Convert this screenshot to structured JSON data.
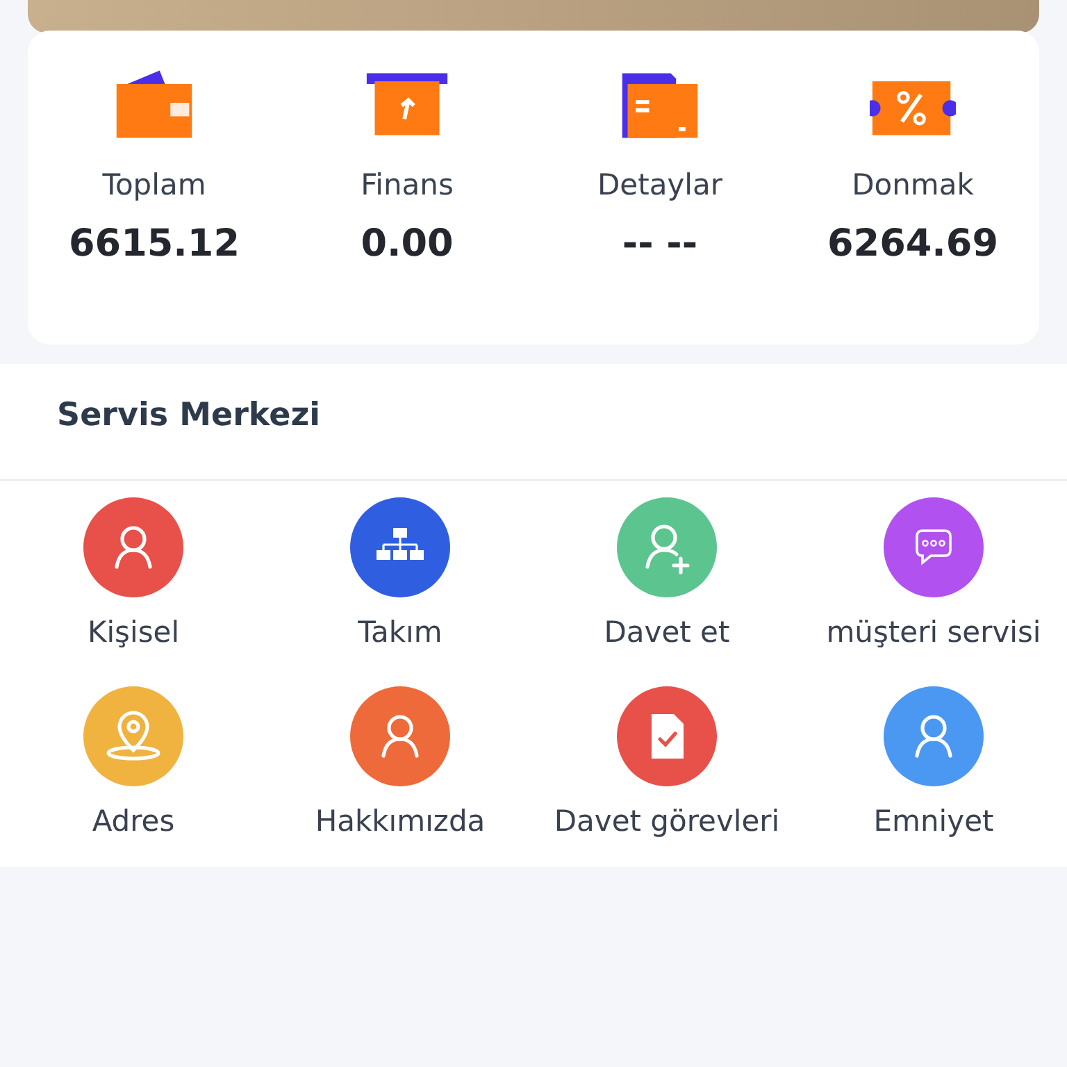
{
  "stats": [
    {
      "kind": "wallet",
      "label": "Toplam",
      "value": "6615.12"
    },
    {
      "kind": "box",
      "label": "Finans",
      "value": "0.00"
    },
    {
      "kind": "card",
      "label": "Detaylar",
      "value": "-- --"
    },
    {
      "kind": "coupon",
      "label": "Donmak",
      "value": "6264.69"
    }
  ],
  "service_center": {
    "title": "Servis Merkezi",
    "items": [
      {
        "kind": "person",
        "label": "Kişisel",
        "color": "#e8504a"
      },
      {
        "kind": "org-chart",
        "label": "Takım",
        "color": "#2f5fe0"
      },
      {
        "kind": "person-add",
        "label": "Davet et",
        "color": "#5cc48e"
      },
      {
        "kind": "chat",
        "label": "müşteri servisi",
        "color": "#b152f0"
      },
      {
        "kind": "location-pin",
        "label": "Adres",
        "color": "#f0b340"
      },
      {
        "kind": "person",
        "label": "Hakkımızda",
        "color": "#ee6a3a"
      },
      {
        "kind": "document-check",
        "label": "Davet görevleri",
        "color": "#e8504a"
      },
      {
        "kind": "person",
        "label": "Emniyet",
        "color": "#4a98f2"
      }
    ]
  }
}
